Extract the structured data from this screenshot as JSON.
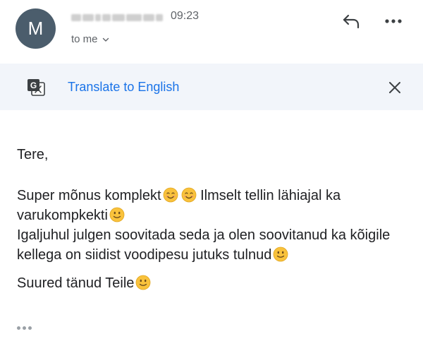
{
  "header": {
    "avatar_letter": "M",
    "time": "09:23",
    "recipient_label": "to me"
  },
  "translate_bar": {
    "link_label": "Translate to English"
  },
  "message": {
    "greeting": "Tere,",
    "para1_a": "Super mõnus komplekt",
    "para1_b": "Ilmselt tellin lähiajal ka varukompkekti",
    "para1_c": "Igaljuhul julgen soovitada seda ja olen soovitanud ka kõigile kellega on siidist voodipesu jutuks tulnud",
    "closing": "Suured tänud Teile"
  },
  "colors": {
    "avatar_bg": "#4b5d6c",
    "link": "#1a73e8",
    "translate_bar_bg": "#f2f5fa",
    "emoji_face": "#f9c23c"
  },
  "icons": [
    "chevron-down-icon",
    "reply-icon",
    "more-options-icon",
    "translate-icon",
    "close-icon",
    "smiling-face-emoji",
    "slightly-smiling-face-emoji",
    "show-trimmed-content-icon"
  ]
}
